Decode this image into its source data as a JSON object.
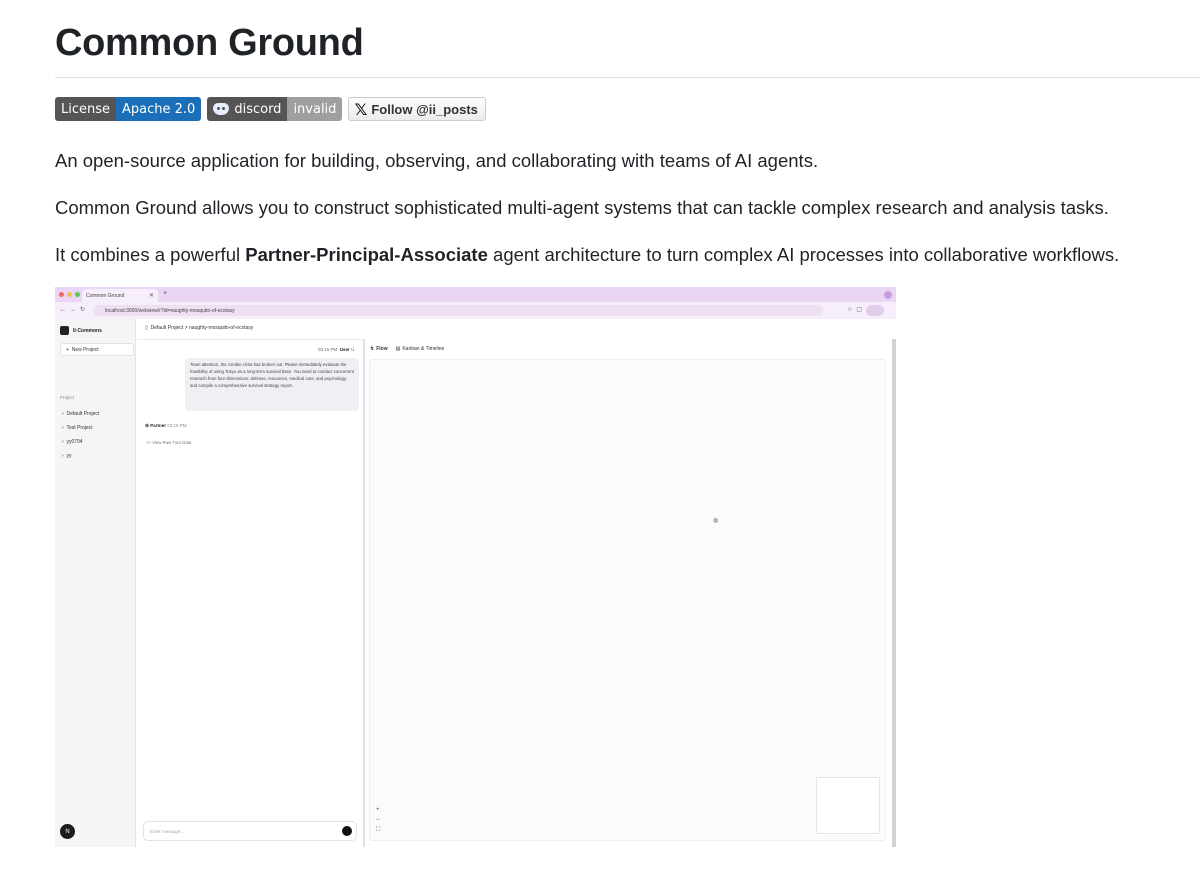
{
  "readme": {
    "title": "Common Ground",
    "badges": [
      {
        "label": "License",
        "value": "Apache 2.0",
        "value_color": "#1b6fb8"
      },
      {
        "label": "discord",
        "value": "invalid",
        "value_color": "#9f9f9f"
      }
    ],
    "follow_badge": "Follow @ii_posts",
    "para1": "An open-source application for building, observing, and collaborating with teams of AI agents.",
    "para2": "Common Ground allows you to construct sophisticated multi-agent systems that can tackle complex research and analysis tasks.",
    "para3_before": "It combines a powerful ",
    "para3_bold": "Partner-Principal-Associate",
    "para3_after": " agent architecture to turn complex AI processes into collaborative workflows."
  },
  "screenshot": {
    "browser_tab": "Common Ground",
    "url": "localhost:3000/webview/r?id=naughty-mosquito-of-ecstasy",
    "sidebar": {
      "brand": "II-Commons",
      "new_project": "New Project",
      "projects_heading": "Project",
      "projects": [
        "Default Project",
        "Test Project",
        "yy0704",
        "yy"
      ],
      "user_initial": "N"
    },
    "breadcrumb": "Default Project  >  naughty-mosquito-of-ecstasy",
    "message": {
      "time": "03:15 PM",
      "author": "User",
      "text": "Team attention, the zombie crisis has broken out. Please immediately evaluate the feasibility of using Tokyo as a long-term survival base. You need to conduct concurrent research from four dimensions: defense, resources, medical care, and psychology, and compile a comprehensive survival strategy report."
    },
    "partner": {
      "name": "Partner",
      "time": "03:15 PM"
    },
    "raw_turn_link": "<> View Raw Turn Data",
    "input_placeholder": "Enter message...",
    "tabs": [
      "Flow",
      "Kanban & Timeline"
    ]
  },
  "colors": {
    "tabbar": "#ead5f4",
    "license_blue": "#1b6fb8",
    "badge_dark": "#555555"
  }
}
